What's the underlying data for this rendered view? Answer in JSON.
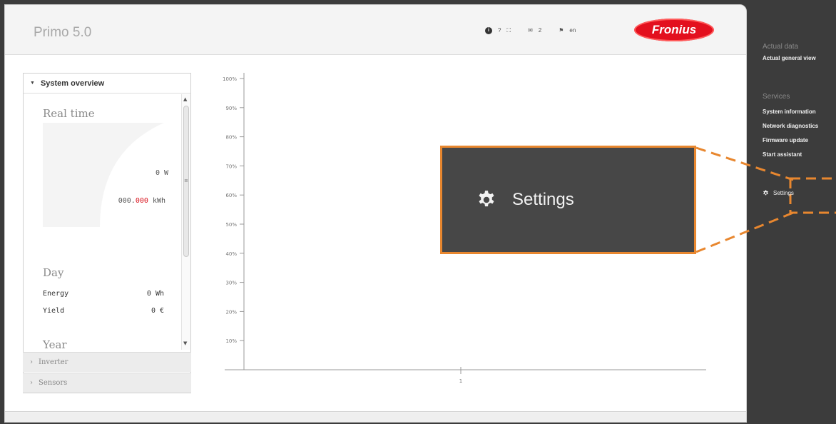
{
  "header": {
    "title": "Primo 5.0",
    "icons": [
      {
        "name": "info-icon",
        "glyph": "i"
      },
      {
        "name": "help-icon",
        "glyph": "?"
      },
      {
        "name": "fullscreen-icon",
        "glyph": "⛶"
      },
      {
        "name": "messages-icon",
        "glyph": "✉"
      },
      {
        "name": "message-count",
        "glyph": "2"
      },
      {
        "name": "language-icon",
        "glyph": "⚑"
      },
      {
        "name": "language-code",
        "glyph": "en"
      }
    ],
    "brand": "Fronius",
    "brand_color": "#e3101e"
  },
  "system_overview": {
    "title": "System overview",
    "real_time": {
      "heading": "Real time",
      "power": "0 W",
      "energy_prefix": "000.",
      "energy_red": "000",
      "energy_unit": "kWh"
    },
    "day": {
      "heading": "Day",
      "rows": [
        {
          "label": "Energy",
          "value": "0 Wh"
        },
        {
          "label": "Yield",
          "value": "0 €"
        }
      ]
    },
    "year": {
      "heading": "Year"
    }
  },
  "accordion": {
    "inverter": "Inverter",
    "sensors": "Sensors"
  },
  "chart_data": {
    "type": "bar",
    "categories": [
      "1"
    ],
    "values": [
      0
    ],
    "yticks": [
      "100%",
      "90%",
      "80%",
      "70%",
      "60%",
      "50%",
      "40%",
      "30%",
      "20%",
      "10%"
    ],
    "ylim": [
      0,
      100
    ],
    "title": "",
    "xlabel": "",
    "ylabel": ""
  },
  "callout": {
    "label": "Settings",
    "border_color": "#e8872f"
  },
  "sidebar": {
    "actual_data": {
      "heading": "Actual data",
      "items": [
        "Actual general view"
      ]
    },
    "services": {
      "heading": "Services",
      "items": [
        "System information",
        "Network diagnostics",
        "Firmware update",
        "Start assistant"
      ]
    },
    "settings": "Settings"
  }
}
